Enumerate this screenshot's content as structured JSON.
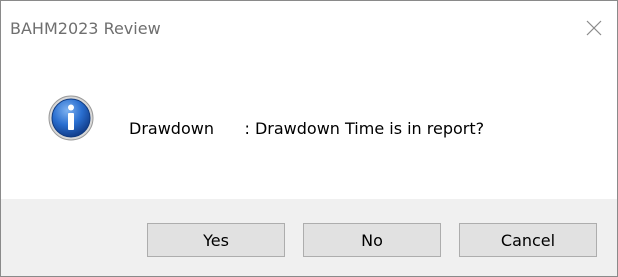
{
  "window": {
    "title": "BAHM2023 Review",
    "close_icon": "close-icon"
  },
  "content": {
    "icon": "info-icon",
    "message": "Drawdown      : Drawdown Time is in report?"
  },
  "buttons": {
    "yes_label": "Yes",
    "no_label": "No",
    "cancel_label": "Cancel"
  },
  "colors": {
    "footer_bg": "#f0f0f0",
    "button_bg": "#e1e1e1",
    "info_blue": "#1f5fbf"
  }
}
